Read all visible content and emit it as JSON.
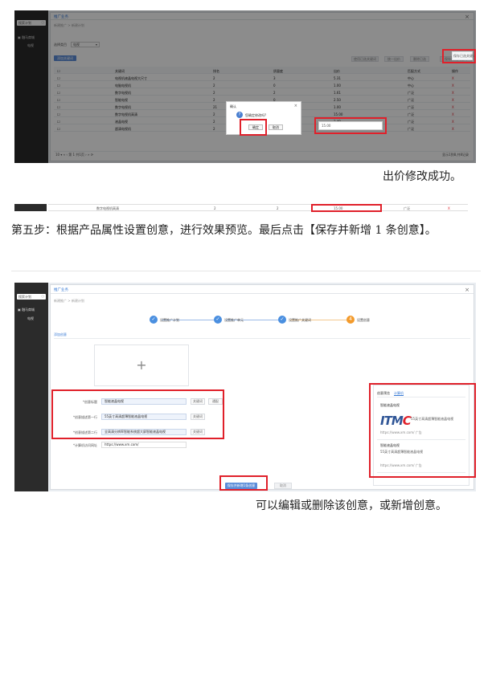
{
  "screenshot1": {
    "sidebar": {
      "search": "搜索计划",
      "menu_item": "融马商城",
      "sub_item": "电视"
    },
    "window_title": "推广业务",
    "breadcrumb": "新建推广 > 新建计划",
    "filter_label": "选择类目",
    "filter_value": "电视",
    "add_keyword_button": "添加关键词",
    "toolbar_buttons": [
      "使用已选关键词",
      "统一出价",
      "删除已选",
      "保存已选关键词"
    ],
    "columns": [
      "关键词",
      "排名",
      "质量度",
      "出价",
      "匹配方式",
      "操作"
    ],
    "rows": [
      [
        "电视机液晶电视大尺寸",
        "2",
        "3",
        "5.31",
        "中心",
        "X"
      ],
      [
        "电脑电视机",
        "2",
        "0",
        "1.00",
        "中心",
        "X"
      ],
      [
        "数字电视机",
        "2",
        "2",
        "1.61",
        "广泛",
        "X"
      ],
      [
        "智能电视",
        "2",
        "0",
        "2.50",
        "广泛",
        "X"
      ],
      [
        "数字电视机",
        "21",
        "3",
        "1.00",
        "广泛",
        "X"
      ],
      [
        "数字电视机高清",
        "2",
        "",
        "15.00",
        "广泛",
        "X"
      ],
      [
        "液晶电视",
        "2",
        "7",
        "3.40",
        "广泛",
        "X"
      ],
      [
        "超清电视机",
        "2",
        "8",
        "15.21",
        "广泛",
        "X"
      ]
    ],
    "pagination": "10 ▾  «  ‹  第 1 共1页  ›  »  ⟳",
    "pagination_right": "显示1到8,共8记录",
    "modal": {
      "title": "确认",
      "message": "您确定修改吗?",
      "confirm": "确定",
      "cancel": "取消"
    }
  },
  "caption1": "出价修改成功。",
  "strip_row": [
    "数字电视机高清",
    "2",
    "2",
    "15.00",
    "广泛",
    "X"
  ],
  "step_text": "第五步：根据产品属性设置创意，进行效果预览。最后点击【保存并新增 1 条创意】。",
  "screenshot2": {
    "sidebar": {
      "search": "搜索计划",
      "menu_item": "融马商城",
      "sub_item": "电视"
    },
    "window_title": "推广业务",
    "breadcrumb": "新建推广 > 新建计划",
    "steps": [
      {
        "num": "✓",
        "label": "设置推广计划"
      },
      {
        "num": "✓",
        "label": "设置推广单元"
      },
      {
        "num": "✓",
        "label": "设置推广关键词"
      },
      {
        "num": "4",
        "label": "设置创意"
      }
    ],
    "section_label": "添加创意",
    "upload_plus": "+",
    "fields": [
      {
        "label": "*创意标题",
        "value": "智能液晶电视",
        "buttons": [
          "关键词",
          "通配"
        ]
      },
      {
        "label": "*创意描述第一行",
        "value": "55英寸高清超薄智能液晶电视",
        "buttons": [
          "关键词"
        ]
      },
      {
        "label": "*创意描述第二行",
        "value": "全高清分辨率智能系统超大屏智能液晶电视",
        "buttons": [
          "关键词"
        ]
      }
    ],
    "url_label": "*计算机访问网址",
    "url_value": "https://www.xm.com/",
    "preview": {
      "tabs": [
        "创意预览",
        "计算机"
      ],
      "title1": "智能液晶电视",
      "logo_text": "ITM",
      "logo_red": "C",
      "logo_caption": "55英寸高清超薄智能液晶电视",
      "url1": "https://www.xm.com/  广告",
      "title2": "智能液晶电视",
      "desc2": "55英寸高清超薄智能液晶电视",
      "url2": "https://www.xm.com/  广告"
    },
    "save_button": "保存并新增1条创意",
    "cancel_button": "取消"
  },
  "caption2": "可以编辑或删除该创意，或新增创意。"
}
